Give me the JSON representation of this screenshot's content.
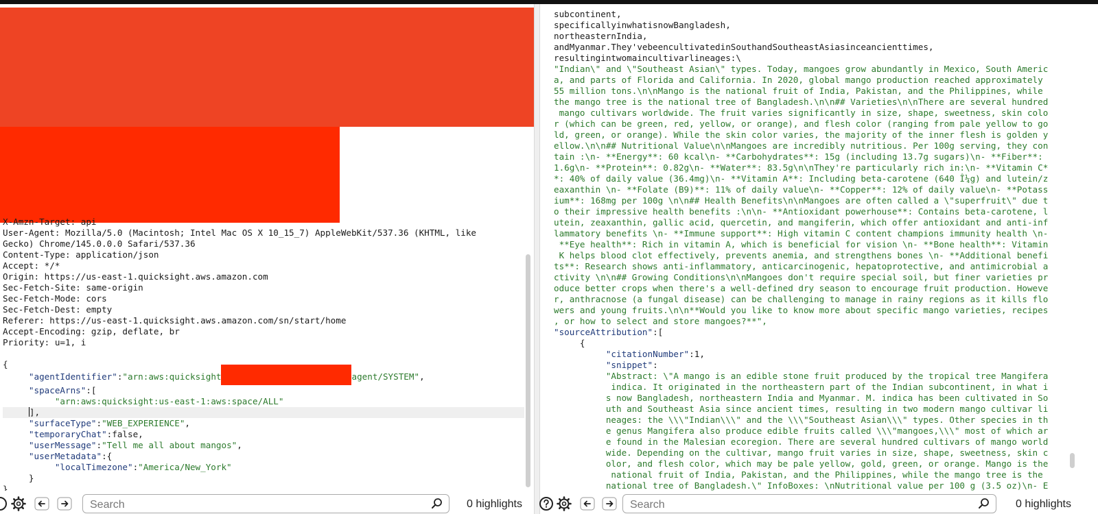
{
  "left_pane": {
    "header_lines": [
      {
        "key": "X-Amzn-Target",
        "value": "api"
      },
      {
        "key": "User-Agent",
        "value": "Mozilla/5.0 (Macintosh; Intel Mac OS X 10_15_7) AppleWebKit/537.36 (KHTML, like"
      },
      {
        "key": "",
        "value": "Gecko) Chrome/145.0.0.0 Safari/537.36"
      },
      {
        "key": "Content-Type",
        "value": "application/json"
      },
      {
        "key": "Accept",
        "value": "*/*"
      },
      {
        "key": "Origin",
        "value": "https://us-east-1.quicksight.aws.amazon.com"
      },
      {
        "key": "Sec-Fetch-Site",
        "value": "same-origin"
      },
      {
        "key": "Sec-Fetch-Mode",
        "value": "cors"
      },
      {
        "key": "Sec-Fetch-Dest",
        "value": "empty"
      },
      {
        "key": "Referer",
        "value": "https://us-east-1.quicksight.aws.amazon.com/sn/start/home"
      },
      {
        "key": "Accept-Encoding",
        "value": "gzip, deflate, br"
      },
      {
        "key": "Priority",
        "value": "u=1, i"
      }
    ],
    "body": {
      "agentIdentifier_key": "\"agentIdentifier\"",
      "agentIdentifier_prefix": "\"arn:aws:quicksight",
      "agentIdentifier_suffix": "agent/SYSTEM\"",
      "spaceArns_key": "\"spaceArns\"",
      "spaceArns_value": "\"arn:aws:quicksight:us-east-1:aws:space/ALL\"",
      "surfaceType_key": "\"surfaceType\"",
      "surfaceType_value": "\"WEB_EXPERIENCE\"",
      "temporaryChat_key": "\"temporaryChat\"",
      "temporaryChat_value": "false",
      "userMessage_key": "\"userMessage\"",
      "userMessage_value": "\"Tell me all about mangos\"",
      "userMetadata_key": "\"userMetadata\"",
      "localTimezone_key": "\"localTimezone\"",
      "localTimezone_value": "\"America/New_York\""
    }
  },
  "right_pane": {
    "plain_lines": [
      "subcontinent,",
      "specificallyinwhatisnowBangladesh,",
      "northeasternIndia,",
      "andMyanmar.They'vebeencultivatedinSouthandSoutheastAsiasinceancienttimes,",
      "resultingintwomaincultivarlineages:\\"
    ],
    "text_lines": [
      "\"Indian\\\" and \\\"Southeast Asian\\\" types. Today, mangoes grow abundantly in Mexico, South Americ",
      "a, and parts of Florida and California. In 2020, global mango production reached approximately",
      "55 million tons.\\n\\nMango is the national fruit of India, Pakistan, and the Philippines, while",
      "the mango tree is the national tree of Bangladesh.\\n\\n## Varieties\\n\\nThere are several hundred",
      " mango cultivars worldwide. The fruit varies significantly in size, shape, sweetness, skin colo",
      "r (which can be green, red, yellow, or orange), and flesh color (ranging from pale yellow to go",
      "ld, green, or orange). While the skin color varies, the majority of the inner flesh is golden y",
      "ellow.\\n\\n## Nutritional Value\\n\\nMangoes are incredibly nutritious. Per 100g serving, they con",
      "tain :\\n- **Energy**: 60 kcal\\n- **Carbohydrates**: 15g (including 13.7g sugars)\\n- **Fiber**:",
      "1.6g\\n- **Protein**: 0.82g\\n- **Water**: 83.5g\\n\\nThey're particularly rich in:\\n- **Vitamin C*",
      "*: 40% of daily value (36.4mg)\\n- **Vitamin A**: Including beta-carotene (640 Î¼g) and lutein/z",
      "eaxanthin \\n- **Folate (B9)**: 11% of daily value\\n- **Copper**: 12% of daily value\\n- **Potass",
      "ium**: 168mg per 100g \\n\\n## Health Benefits\\n\\nMangoes are often called a \\\"superfruit\\\" due t",
      "o their impressive health benefits :\\n\\n- **Antioxidant powerhouse**: Contains beta-carotene, l",
      "utein, zeaxanthin, gallic acid, quercetin, and mangiferin, which offer antioxidant and anti-inf",
      "lammatory benefits \\n- **Immune support**: High vitamin C content champions immunity health \\n-",
      " **Eye health**: Rich in vitamin A, which is beneficial for vision \\n- **Bone health**: Vitamin",
      " K helps blood clot effectively, prevents anemia, and strengthens bones \\n- **Additional benefi",
      "ts**: Research shows anti-inflammatory, anticarcinogenic, hepatoprotective, and antimicrobial a",
      "ctivity \\n\\n## Growing Conditions\\n\\nMangoes don't require special soil, but finer varieties pr",
      "oduce better crops when there's a well-defined dry season to encourage fruit production. Howeve",
      "r, anthracnose (a fungal disease) can be challenging to manage in rainy regions as it kills flo",
      "wers and young fruits.\\n\\n**Would you like to know more about specific mango varieties, recipes",
      ", or how to select and store mangoes?**\","
    ],
    "sourceAttribution_key": "\"sourceAttribution\"",
    "citationNumber_key": "\"citationNumber\"",
    "citationNumber_value": "1",
    "snippet_key": "\"snippet\"",
    "snippet_lines": [
      "\"Abstract: \\\"A mango is an edible stone fruit produced by the tropical tree Mangifera",
      " indica. It originated in the northeastern part of the Indian subcontinent, in what i",
      "s now Bangladesh, northeastern India and Myanmar. M. indica has been cultivated in So",
      "uth and Southeast Asia since ancient times, resulting in two modern mango cultivar li",
      "neages: the \\\\\\\"Indian\\\\\\\" and the \\\\\\\"Southeast Asian\\\\\\\" types. Other species in th",
      "e genus Mangifera also produce edible fruits called \\\\\\\"mangoes,\\\\\\\" most of which ar",
      "e found in the Malesian ecoregion. There are several hundred cultivars of mango world",
      "wide. Depending on the cultivar, mango fruit varies in size, shape, sweetness, skin c",
      "olor, and flesh color, which may be pale yellow, gold, green, or orange. Mango is the",
      " national fruit of India, Pakistan, and the Philippines, while the mango tree is the",
      "national tree of Bangladesh.\\\" InfoBoxes: \\nNutritional value per 100 g (3.5 oz)\\n- E"
    ]
  },
  "bottom_left": {
    "search_placeholder": "Search",
    "highlights": "0 highlights"
  },
  "bottom_right": {
    "search_placeholder": "Search",
    "highlights": "0 highlights"
  },
  "icons": [
    "help-icon",
    "gear-icon",
    "arrow-left-icon",
    "arrow-right-icon",
    "magnifier-icon"
  ],
  "colors": {
    "redaction": "#ff2a00",
    "string": "#2c7a2c",
    "key": "#1f3a7a"
  }
}
